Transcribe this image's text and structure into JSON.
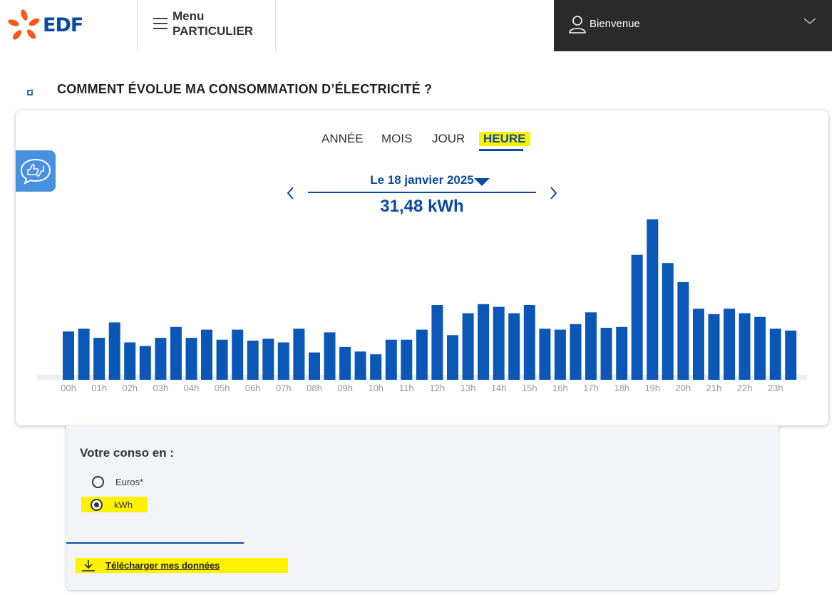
{
  "header": {
    "logo_text": "EDF",
    "menu_line1": "Menu",
    "menu_line2": "PARTICULIER",
    "account_label": "Bienvenue"
  },
  "page": {
    "title": "COMMENT ÉVOLUE MA CONSOMMATION D’ÉLECTRICITÉ ?"
  },
  "tabs": [
    {
      "label": "ANNÉE",
      "active": false
    },
    {
      "label": "MOIS",
      "active": false
    },
    {
      "label": "JOUR",
      "active": false
    },
    {
      "label": "HEURE",
      "active": true
    }
  ],
  "period": {
    "date_label": "Le 18 janvier 2025",
    "total": "31,48 kWh"
  },
  "colors": {
    "bar": "#0a57b8",
    "accent": "#0a4aa3",
    "highlight": "#fff200",
    "header_dark": "#2b2b2b",
    "logo_orange": "#fe5716"
  },
  "chart_data": {
    "type": "bar",
    "x_tick_labels": [
      "00h",
      "01h",
      "02h",
      "03h",
      "04h",
      "05h",
      "06h",
      "07h",
      "08h",
      "09h",
      "10h",
      "11h",
      "12h",
      "13h",
      "14h",
      "15h",
      "16h",
      "17h",
      "18h",
      "19h",
      "20h",
      "21h",
      "22h",
      "23h"
    ],
    "categories": [
      "00h00",
      "00h30",
      "01h00",
      "01h30",
      "02h00",
      "02h30",
      "03h00",
      "03h30",
      "04h00",
      "04h30",
      "05h00",
      "05h30",
      "06h00",
      "06h30",
      "07h00",
      "07h30",
      "08h00",
      "08h30",
      "09h00",
      "09h30",
      "10h00",
      "10h30",
      "11h00",
      "11h30",
      "12h00",
      "12h30",
      "13h00",
      "13h30",
      "14h00",
      "14h30",
      "15h00",
      "15h30",
      "16h00",
      "16h30",
      "17h00",
      "17h30",
      "18h00",
      "18h30",
      "19h00",
      "19h30",
      "20h00",
      "20h30",
      "21h00",
      "21h30",
      "22h00",
      "22h30",
      "23h00",
      "23h30"
    ],
    "values": [
      0.53,
      0.56,
      0.46,
      0.63,
      0.41,
      0.37,
      0.46,
      0.58,
      0.46,
      0.55,
      0.44,
      0.55,
      0.43,
      0.45,
      0.41,
      0.56,
      0.3,
      0.52,
      0.36,
      0.31,
      0.28,
      0.44,
      0.44,
      0.55,
      0.82,
      0.49,
      0.73,
      0.83,
      0.8,
      0.73,
      0.82,
      0.56,
      0.55,
      0.61,
      0.74,
      0.57,
      0.58,
      1.37,
      1.76,
      1.28,
      1.07,
      0.78,
      0.72,
      0.78,
      0.73,
      0.69,
      0.56,
      0.54
    ],
    "grid": false,
    "legend": "none"
  },
  "options": {
    "title": "Votre conso en :",
    "units": [
      {
        "label": "Euros*",
        "checked": false
      },
      {
        "label": "kWh",
        "checked": true
      }
    ],
    "download_label": "Télécharger mes données"
  }
}
